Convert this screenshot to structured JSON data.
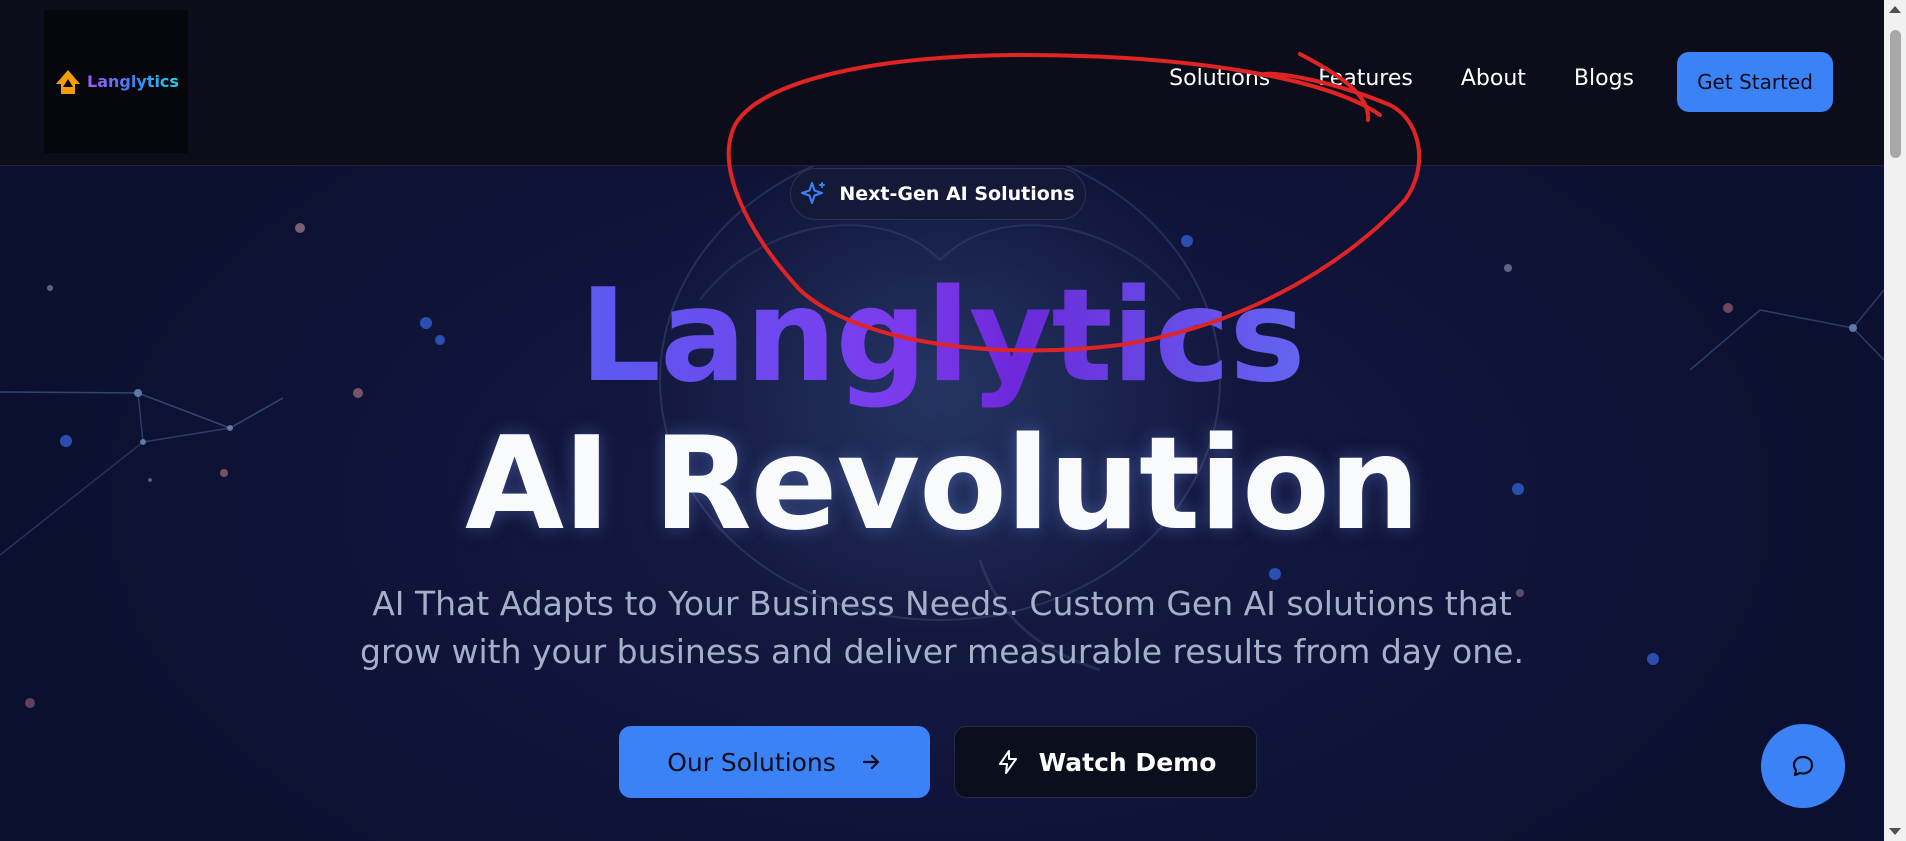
{
  "brand": {
    "name": "Langlytics"
  },
  "nav": {
    "links": [
      "Solutions",
      "Features",
      "About",
      "Blogs"
    ],
    "cta_label": "Get Started"
  },
  "hero": {
    "badge_label": "Next-Gen AI Solutions",
    "badge_icon": "sparkle-icon",
    "title_line1": "Langlytics",
    "title_line2": "AI Revolution",
    "subtitle_line1": "AI That Adapts to Your Business Needs. Custom Gen AI solutions that",
    "subtitle_line2": "grow with your business and deliver measurable results from day one.",
    "primary_button": "Our Solutions",
    "primary_icon": "arrow-right-icon",
    "secondary_button": "Watch Demo",
    "secondary_icon": "lightning-icon"
  },
  "chat": {
    "icon": "chat-bubble-icon"
  },
  "colors": {
    "accent": "#3b82f6",
    "nav_bg": "#0b0e1a",
    "hero_bg": "#10143a",
    "title_gradient_start": "#5b5bf0",
    "title_gradient_end": "#7c3aed",
    "annotation": "#e02424"
  }
}
